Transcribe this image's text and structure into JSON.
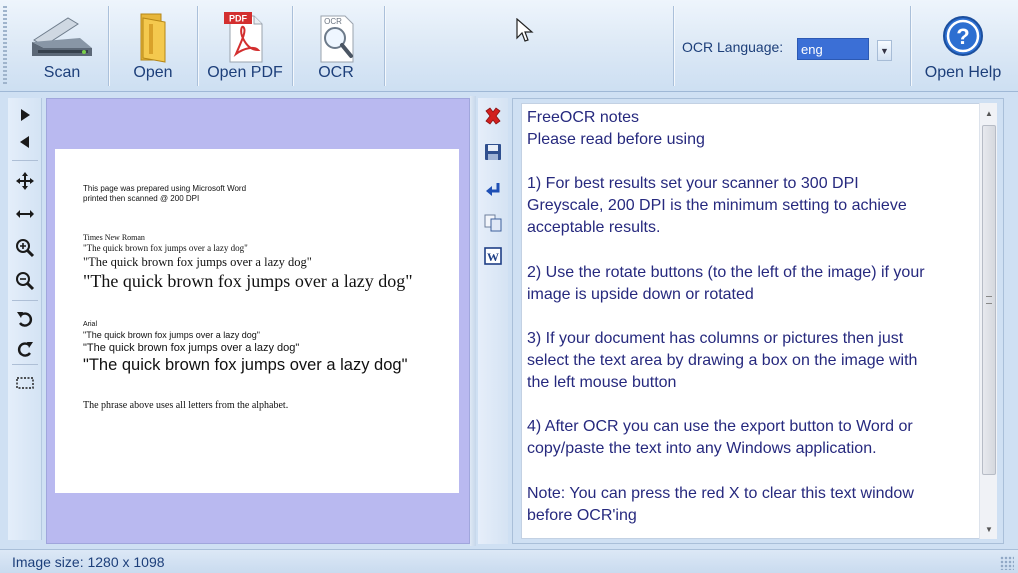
{
  "toolbar": {
    "scan_label": "Scan",
    "open_label": "Open",
    "open_pdf_label": "Open PDF",
    "ocr_label": "OCR",
    "help_label": "Open Help",
    "pdf_badge": "PDF",
    "ocr_badge": "OCR",
    "ocr_language_label": "OCR Language:",
    "ocr_language_value": "eng"
  },
  "left_tools": [
    {
      "name": "next-page-icon"
    },
    {
      "name": "previous-page-icon"
    },
    {
      "name": "move-icon"
    },
    {
      "name": "fit-width-icon"
    },
    {
      "name": "zoom-in-icon"
    },
    {
      "name": "zoom-out-icon"
    },
    {
      "name": "rotate-left-icon"
    },
    {
      "name": "rotate-right-icon"
    },
    {
      "name": "select-area-icon"
    }
  ],
  "scanned_page": {
    "line1": "This page was prepared using Microsoft Word",
    "line2": "printed then scanned @ 200 DPI",
    "serif_heading": "Times New Roman",
    "serif_small": "\"The quick brown fox jumps over a lazy dog\"",
    "serif_medium": "\"The quick brown fox jumps over a lazy dog\"",
    "serif_large": "\"The quick brown fox jumps over a lazy dog\"",
    "sans_heading": "Arial",
    "sans_small": "\"The quick brown fox jumps over a lazy dog\"",
    "sans_medium": "\"The quick brown fox  jumps over a lazy dog\"",
    "sans_large": "\"The quick brown fox jumps over a lazy dog\"",
    "footer": "The phrase above uses all letters from the alphabet."
  },
  "ocr_text": [
    "FreeOCR notes",
    "Please read before using",
    "",
    "1) For best results set your scanner to 300 DPI",
    "Greyscale, 200 DPI is the minimum setting to achieve",
    "acceptable results.",
    "",
    "2) Use the rotate buttons (to the left of the image) if your",
    "image is upside down or rotated",
    "",
    "3) If your document has columns or pictures then just",
    "select the text area by drawing a box on the image with",
    "the left mouse button",
    "",
    "4) After OCR you can use the export button to Word or",
    "copy/paste the text into any Windows application.",
    "",
    "Note: You can press the red X to clear this text window",
    "before OCR'ing"
  ],
  "status": {
    "image_size": "Image size:  1280 x 1098"
  },
  "colors": {
    "image_panel_bg": "#b9b9f0",
    "ocr_text_color": "#26297e",
    "clear_button": "#d21f1f",
    "language_select_bg": "#3b6fd6"
  }
}
